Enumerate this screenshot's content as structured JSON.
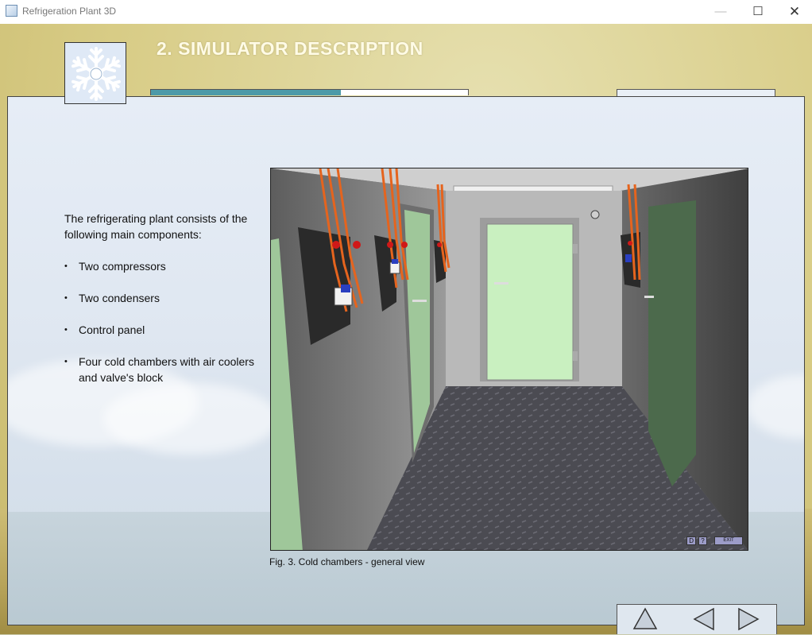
{
  "window": {
    "title": "Refrigeration Plant 3D",
    "minimize_icon": "minimize-icon",
    "maximize_icon": "maximize-icon",
    "close_icon": "close-icon"
  },
  "header": {
    "title": "2. SIMULATOR DESCRIPTION",
    "logo_icon": "snowflake-icon",
    "progress_fraction": 0.6
  },
  "content": {
    "intro": "The refrigerating plant consists of the following main components:",
    "components": [
      "Two compressors",
      "Two condensers",
      "Control panel",
      "Four cold chambers with air coolers and valve's block"
    ]
  },
  "figure": {
    "caption": "Fig. 3. Cold chambers - general view",
    "controls": {
      "d": "D",
      "help": "?",
      "exit": "EXIT"
    }
  },
  "nav": {
    "up_icon": "up-triangle-icon",
    "prev_icon": "left-triangle-icon",
    "next_icon": "right-triangle-icon"
  },
  "colors": {
    "accent": "#4d9aa8",
    "door_green": "#c9f0c0",
    "pipe_orange": "#e5641e"
  }
}
